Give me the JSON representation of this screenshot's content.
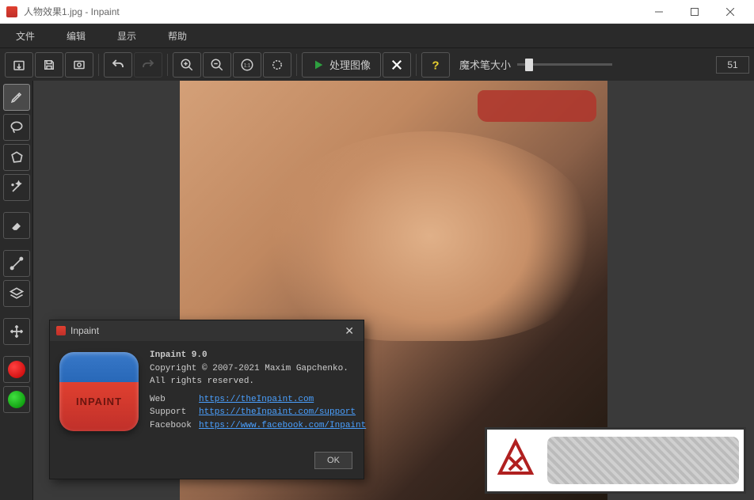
{
  "window": {
    "title": "人物效果1.jpg - Inpaint"
  },
  "menu": {
    "file": "文件",
    "edit": "编辑",
    "view": "显示",
    "help": "帮助"
  },
  "toolbar": {
    "process_label": "处理图像",
    "brush_label": "魔术笔大小",
    "brush_value": "51"
  },
  "dialog": {
    "title": "Inpaint",
    "product": "Inpaint 9.0",
    "copyright": "Copyright © 2007-2021 Maxim Gapchenko.",
    "rights": "All rights reserved.",
    "web_label": "Web",
    "web_url": "https://theInpaint.com",
    "support_label": "Support",
    "support_url": "https://theInpaint.com/support",
    "facebook_label": "Facebook",
    "facebook_url": "https://www.facebook.com/Inpaint",
    "ok": "OK"
  }
}
